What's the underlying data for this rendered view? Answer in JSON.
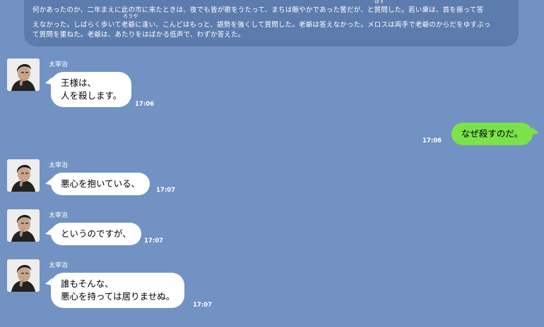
{
  "narration": {
    "line1": "何かあったのか、二年まえに此の市に来たときは、夜でも皆が歌をうたって、まちは賑やかであった筈だが、と質問した。若い衆は、首を振って答",
    "line2": "えなかった。しばらく歩いて老爺に逢い、こんどはもっと、語勢を強くして質問した。老爺は答えなかった。メロスは両手で老爺のからだをゆすぶっ",
    "line3": "て質問を重ねた。老爺は、あたりをはばかる低声で、わずか答えた。",
    "ruby_hazu": "はず",
    "ruby_rouya": "ろうや"
  },
  "messages": [
    {
      "sender": "太宰治",
      "side": "left",
      "lines": [
        "王様は、",
        "人を殺します。"
      ],
      "time": "17:06"
    },
    {
      "sender": "",
      "side": "right",
      "lines": [
        "なぜ殺すのだ。"
      ],
      "time": "17:06"
    },
    {
      "sender": "太宰治",
      "side": "left",
      "lines": [
        "悪心を抱いている、"
      ],
      "time": "17:07"
    },
    {
      "sender": "太宰治",
      "side": "left",
      "lines": [
        "というのですが、"
      ],
      "time": "17:07"
    },
    {
      "sender": "太宰治",
      "side": "left",
      "lines": [
        "誰もそんな、",
        "悪心を持っては居りませぬ。"
      ],
      "time": "17:07"
    }
  ],
  "colors": {
    "background": "#7292c3",
    "narration_box": "#5d7cae",
    "bubble_other": "#ffffff",
    "bubble_self": "#7be24a"
  }
}
